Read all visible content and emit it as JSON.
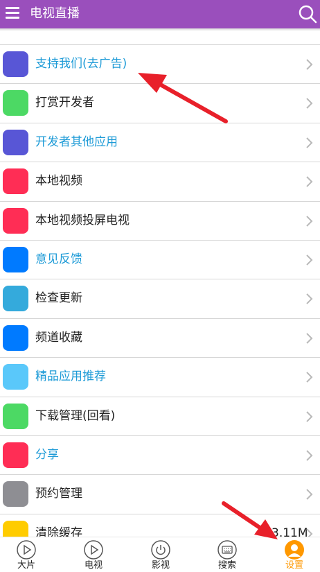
{
  "header": {
    "title": "电视直播",
    "menu_icon": "menu-icon",
    "search_icon": "search-icon",
    "color": "#9a4fbc"
  },
  "settings": {
    "items": [
      {
        "label": "支持我们(去广告)",
        "color": "#5856d6",
        "blue": true
      },
      {
        "label": "打赏开发者",
        "color": "#4cd964",
        "blue": false
      },
      {
        "label": "开发者其他应用",
        "color": "#5856d6",
        "blue": true
      },
      {
        "label": "本地视频",
        "color": "#ff2d55",
        "blue": false
      },
      {
        "label": "本地视频投屏电视",
        "color": "#ff2d55",
        "blue": false
      },
      {
        "label": "意见反馈",
        "color": "#007aff",
        "blue": true
      },
      {
        "label": "检查更新",
        "color": "#34aadc",
        "blue": false
      },
      {
        "label": "频道收藏",
        "color": "#007aff",
        "blue": false
      },
      {
        "label": "精品应用推荐",
        "color": "#5ac8fa",
        "blue": true
      },
      {
        "label": "下载管理(回看)",
        "color": "#4cd964",
        "blue": false
      },
      {
        "label": "分享",
        "color": "#ff2d55",
        "blue": true
      },
      {
        "label": "预约管理",
        "color": "#8e8e93",
        "blue": false
      },
      {
        "label": "清除缓存",
        "color": "#ffcc00",
        "blue": false,
        "value": "3.11M"
      }
    ]
  },
  "tabs": [
    {
      "label": "大片",
      "icon": "play-icon"
    },
    {
      "label": "电视",
      "icon": "play-icon"
    },
    {
      "label": "影视",
      "icon": "power-icon"
    },
    {
      "label": "搜索",
      "icon": "keyboard-icon"
    },
    {
      "label": "设置",
      "icon": "user-icon",
      "active": true
    }
  ],
  "accent": "#ff9800",
  "annotation_color": "#e8202a"
}
